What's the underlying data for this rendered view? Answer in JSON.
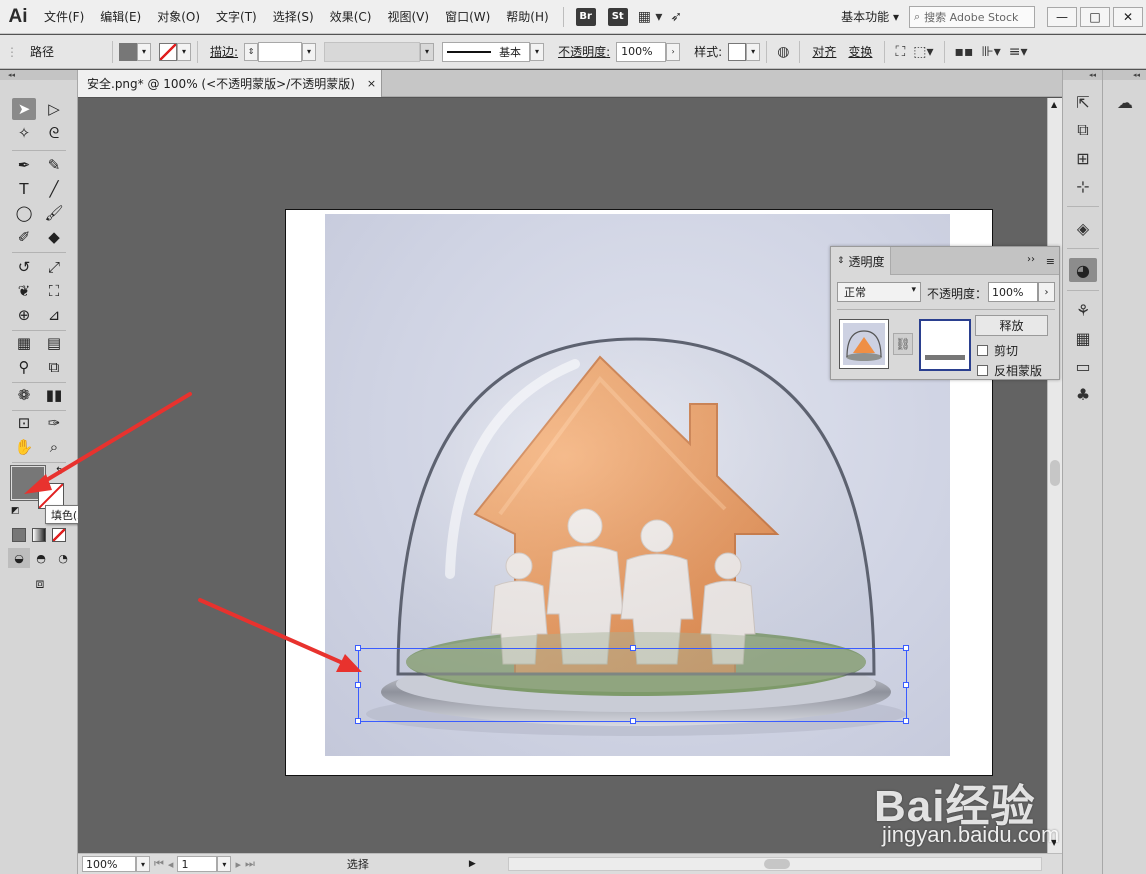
{
  "app": {
    "logo": "Ai"
  },
  "menu": [
    "文件(F)",
    "编辑(E)",
    "对象(O)",
    "文字(T)",
    "选择(S)",
    "效果(C)",
    "视图(V)",
    "窗口(W)",
    "帮助(H)"
  ],
  "bridge_labels": {
    "br": "Br",
    "st": "St"
  },
  "workspace": "基本功能",
  "search_placeholder": "搜索 Adobe Stock",
  "window_controls": {
    "minimize": "—",
    "restore": "□",
    "close": "✕"
  },
  "control_bar": {
    "selection_type": "路径",
    "stroke_label": "描边",
    "brush_label": "基本",
    "opacity_label": "不透明度",
    "opacity_value": "100%",
    "style_label": "样式",
    "align_label": "对齐",
    "transform_label": "变换",
    "colon": ":"
  },
  "document_tab": {
    "title": "安全.png* @ 100% (<不透明蒙版>/不透明蒙版)",
    "close": "×"
  },
  "tooltip": "填色(X)",
  "status": {
    "zoom": "100%",
    "page": "1",
    "tool": "选择"
  },
  "transparency_panel": {
    "title": "透明度",
    "more": "››",
    "blend_mode": "正常",
    "opacity_label": "不透明度：",
    "opacity_value": "100%",
    "release_button": "释放",
    "clip_label": "剪切",
    "invert_label": "反相蒙版"
  },
  "watermark": {
    "brand": "Bai经验",
    "url": "jingyan.baidu.com"
  },
  "colors": {
    "accent": "#3a5cff",
    "arrow": "#e8322e",
    "house": "#f0924a",
    "fill": "#777777"
  }
}
